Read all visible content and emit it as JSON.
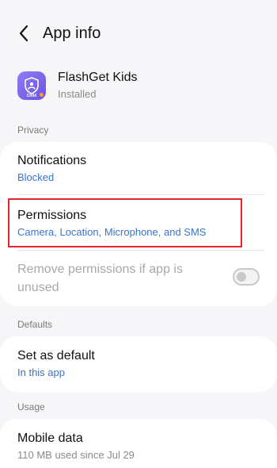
{
  "header": {
    "title": "App info",
    "back_icon": "chevron-left-icon"
  },
  "app": {
    "name": "FlashGet Kids",
    "status": "Installed",
    "icon_badge": "Child",
    "icon_color": "#7b68ee"
  },
  "sections": {
    "privacy": "Privacy",
    "defaults": "Defaults",
    "usage": "Usage"
  },
  "privacy": {
    "notifications": {
      "title": "Notifications",
      "value": "Blocked"
    },
    "permissions": {
      "title": "Permissions",
      "value": "Camera, Location, Microphone, and SMS"
    },
    "remove_permissions": {
      "title": "Remove permissions if app is unused",
      "enabled": false
    }
  },
  "defaults": {
    "set_as_default": {
      "title": "Set as default",
      "value": "In this app"
    }
  },
  "usage": {
    "mobile_data": {
      "title": "Mobile data",
      "value": "110 MB used since Jul 29"
    }
  },
  "colors": {
    "link_blue": "#3a74c9",
    "highlight_red": "#e0282e",
    "background": "#f6f6f8"
  }
}
